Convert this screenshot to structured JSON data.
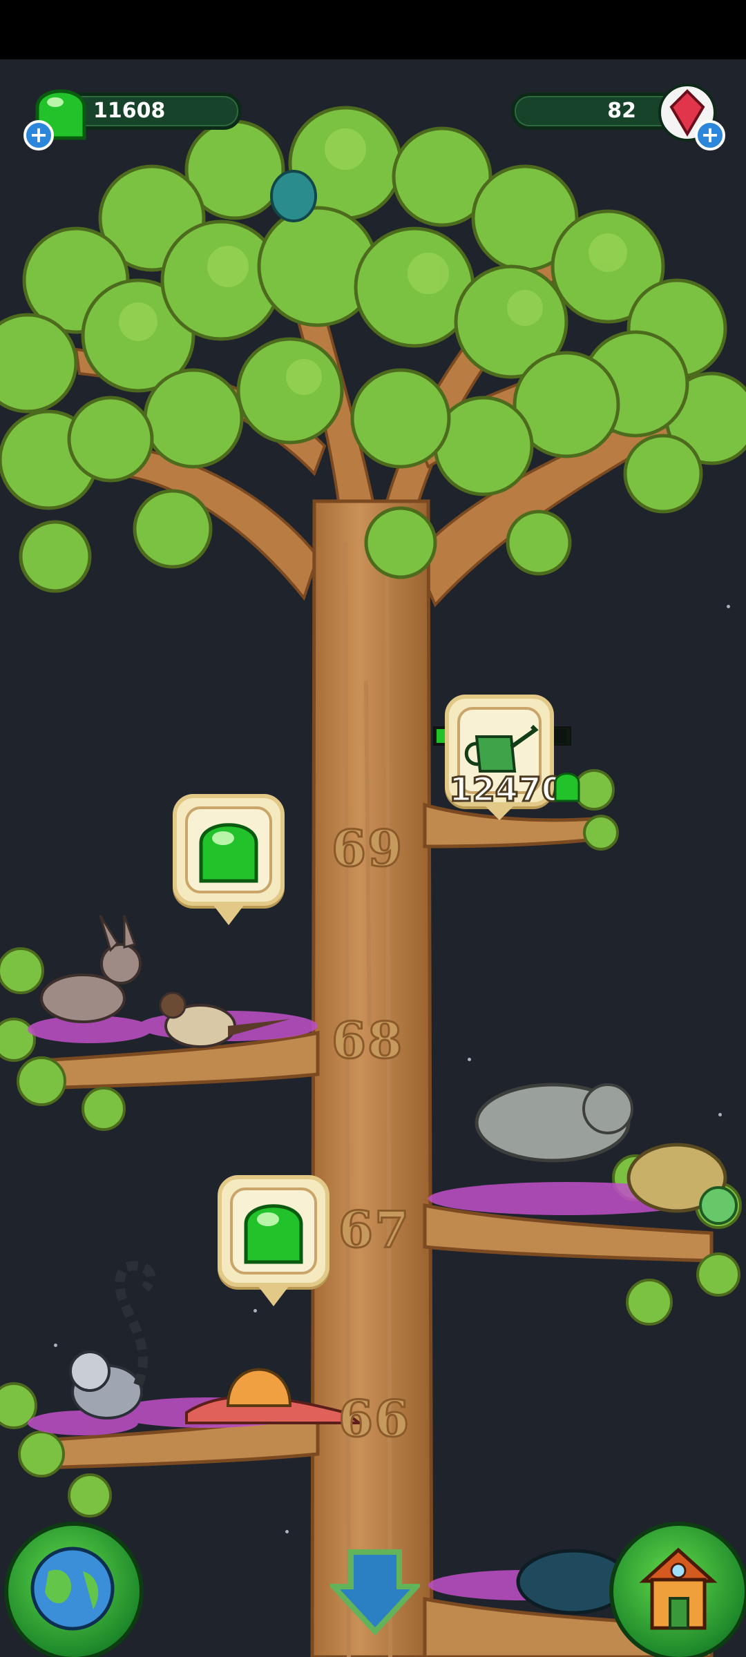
{
  "hud": {
    "gems_value": "11608",
    "crystals_value": "82",
    "plus_symbol": "+"
  },
  "tree": {
    "level_numbers": [
      "69",
      "68",
      "67",
      "66"
    ]
  },
  "task": {
    "cost_value": "12470",
    "progress_fraction": 0.5,
    "icon": "watering-can-icon"
  },
  "colors": {
    "leaf": "#7cc242",
    "trunk": "#c08a4e",
    "gem_green": "#22c22a",
    "hud_bar": "#16432a"
  },
  "icons": [
    "green-gem-icon",
    "red-crystal-icon",
    "plus-icon",
    "globe-icon",
    "down-arrow-icon",
    "house-icon"
  ]
}
